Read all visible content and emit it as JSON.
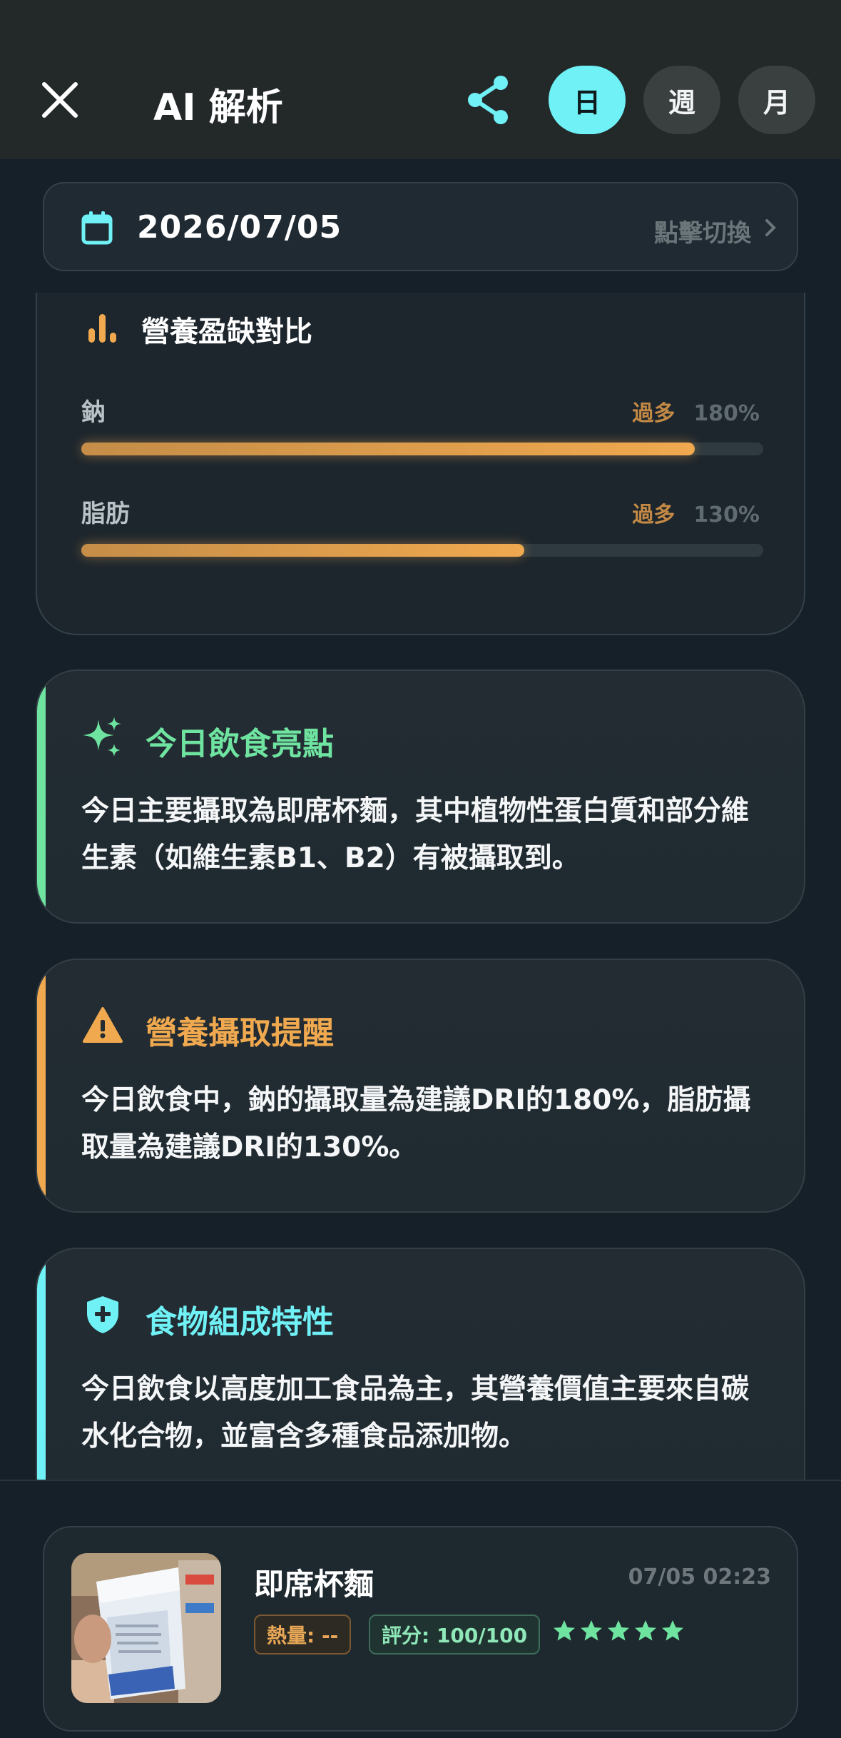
{
  "header": {
    "title": "AI 解析",
    "periods": [
      "日",
      "週",
      "月"
    ],
    "active_period": "日",
    "accent_color": "#6ff1f6"
  },
  "date_bar": {
    "date": "2026/07/05",
    "switch_label": "點擊切換"
  },
  "nutrition": {
    "title": "營養盈缺對比",
    "items": [
      {
        "label": "鈉",
        "status": "過多",
        "percent_text": "180%",
        "fill_fraction": 0.9
      },
      {
        "label": "脂肪",
        "status": "過多",
        "percent_text": "130%",
        "fill_fraction": 0.65
      }
    ]
  },
  "insights": [
    {
      "title": "今日飲食亮點",
      "icon": "sparkle-icon",
      "color": "#6fe3a0",
      "body": "今日主要攝取為即席杯麵，其中植物性蛋白質和部分維生素（如維生素B1、B2）有被攝取到。"
    },
    {
      "title": "營養攝取提醒",
      "icon": "warning-icon",
      "color": "#f0a94f",
      "body": "今日飲食中，鈉的攝取量為建議DRI的180%，脂肪攝取量為建議DRI的130%。"
    },
    {
      "title": "食物組成特性",
      "icon": "shield-plus-icon",
      "color": "#6ff1f6",
      "body": "今日飲食以高度加工食品為主，其營養價值主要來自碳水化合物，並富含多種食品添加物。"
    }
  ],
  "food": {
    "name": "即席杯麵",
    "time": "07/05 02:23",
    "calories_tag": "熱量: --",
    "score_tag": "評分: 100/100",
    "stars": 5
  }
}
